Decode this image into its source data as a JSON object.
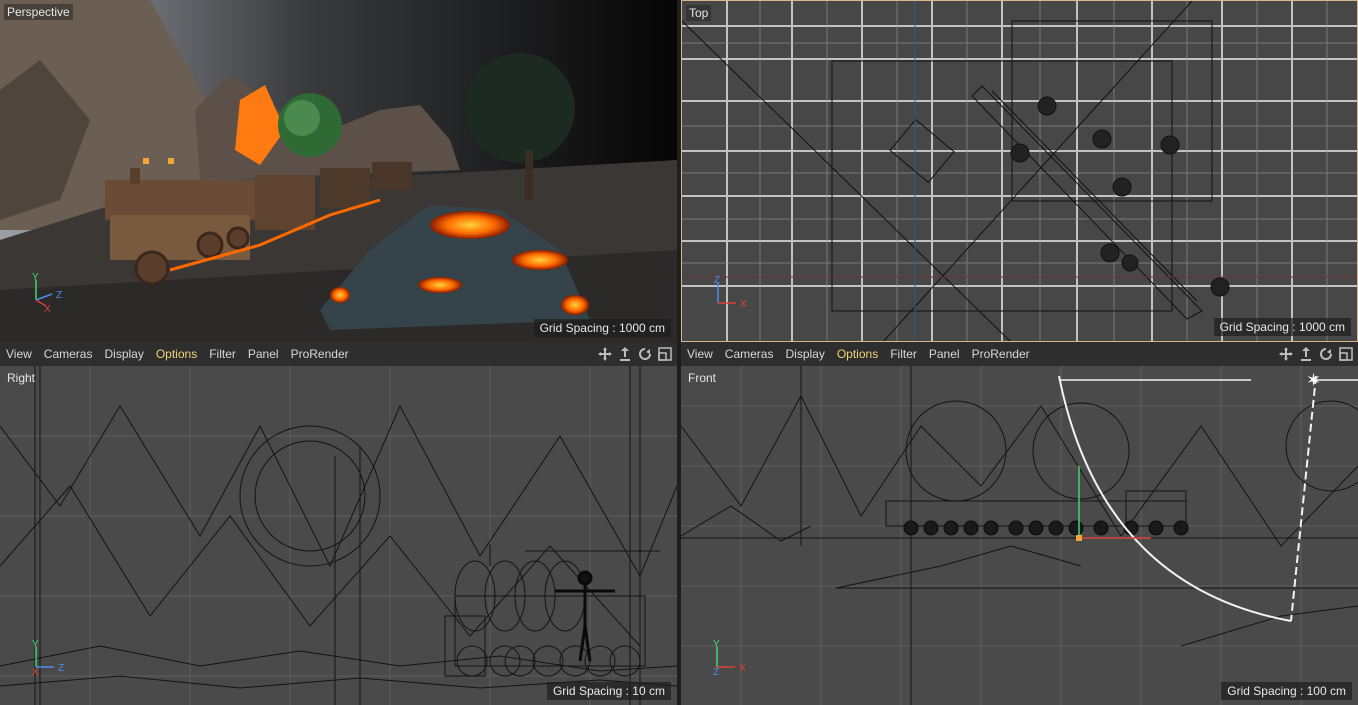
{
  "viewports": {
    "perspective": {
      "label": "Perspective",
      "grid_spacing": "Grid Spacing : 1000 cm"
    },
    "top": {
      "label": "Top",
      "grid_spacing": "Grid Spacing : 1000 cm"
    },
    "right": {
      "label": "Right",
      "grid_spacing": "Grid Spacing : 10 cm"
    },
    "front": {
      "label": "Front",
      "grid_spacing": "Grid Spacing : 100 cm"
    }
  },
  "menu": {
    "items": [
      "View",
      "Cameras",
      "Display",
      "Options",
      "Filter",
      "Panel",
      "ProRender"
    ],
    "active": "Options"
  },
  "nav_icons": [
    "move-icon",
    "dolly-icon",
    "rotate-icon",
    "maximize-icon"
  ],
  "axes": {
    "x": "X",
    "y": "Y",
    "z": "Z"
  },
  "colors": {
    "active_menu": "#f2d37a",
    "lava": "#ff6a00",
    "axis_x": "#e0403a",
    "axis_y": "#3fd86a",
    "axis_z": "#4a8cf0"
  }
}
